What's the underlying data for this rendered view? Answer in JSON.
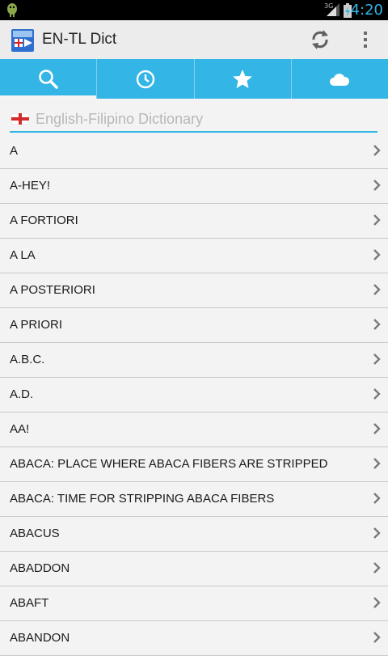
{
  "status_bar": {
    "network": "3G",
    "time": "4:20"
  },
  "app": {
    "title": "EN-TL Dict"
  },
  "tabs": [
    {
      "icon": "search-icon",
      "selected": true
    },
    {
      "icon": "history-icon",
      "selected": false
    },
    {
      "icon": "star-icon",
      "selected": false
    },
    {
      "icon": "cloud-icon",
      "selected": false
    }
  ],
  "search": {
    "placeholder": "English-Filipino Dictionary",
    "value": ""
  },
  "words": [
    "A",
    "A-HEY!",
    "A FORTIORI",
    "A LA",
    "A POSTERIORI",
    "A PRIORI",
    "A.B.C.",
    "A.D.",
    "AA!",
    "ABACA: PLACE WHERE ABACA FIBERS ARE STRIPPED",
    "ABACA: TIME FOR STRIPPING ABACA FIBERS",
    "ABACUS",
    "ABADDON",
    "ABAFT",
    "ABANDON"
  ],
  "colors": {
    "accent": "#33b5e5",
    "background": "#f3f3f3",
    "action_bar": "#ececec",
    "status_bar": "#000000"
  }
}
